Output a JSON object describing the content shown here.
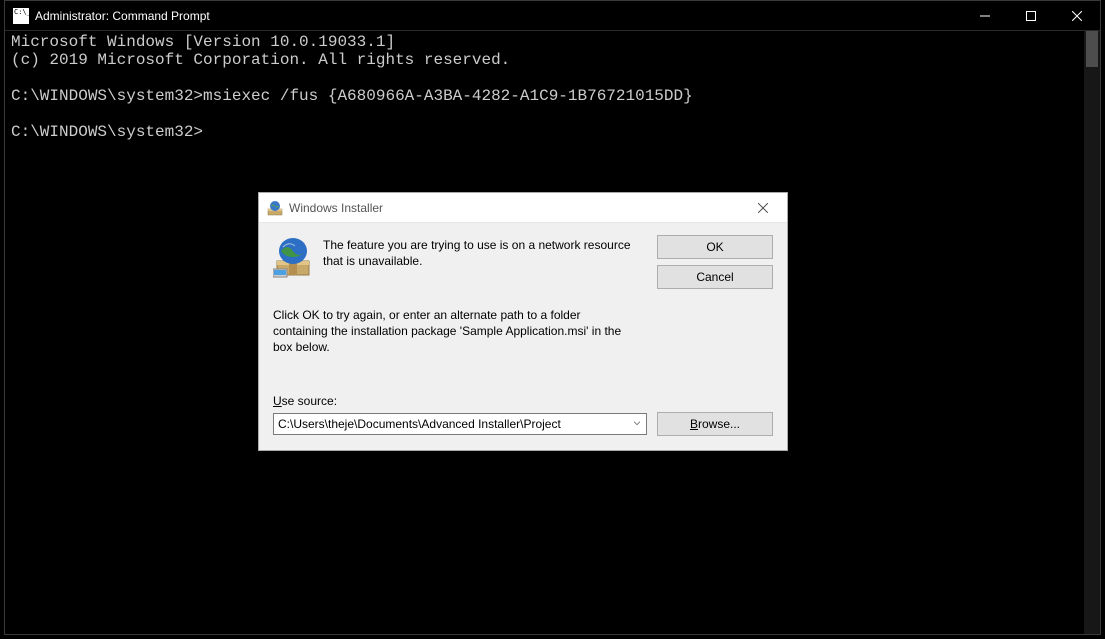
{
  "cmd": {
    "title": "Administrator: Command Prompt",
    "lines": {
      "l1": "Microsoft Windows [Version 10.0.19033.1]",
      "l2": "(c) 2019 Microsoft Corporation. All rights reserved.",
      "l3": "",
      "l4": "C:\\WINDOWS\\system32>msiexec /fus {A680966A-A3BA-4282-A1C9-1B76721015DD}",
      "l5": "",
      "l6": "C:\\WINDOWS\\system32>"
    }
  },
  "dialog": {
    "title": "Windows Installer",
    "message": "The feature you are trying to use is on a network resource that is unavailable.",
    "instruction": "Click OK to try again, or enter an alternate path to a folder containing the installation package 'Sample Application.msi' in the box below.",
    "use_source_label": "Use source:",
    "source_value": "C:\\Users\\theje\\Documents\\Advanced Installer\\Project",
    "ok_label": "OK",
    "cancel_label": "Cancel",
    "browse_label": "Browse..."
  }
}
